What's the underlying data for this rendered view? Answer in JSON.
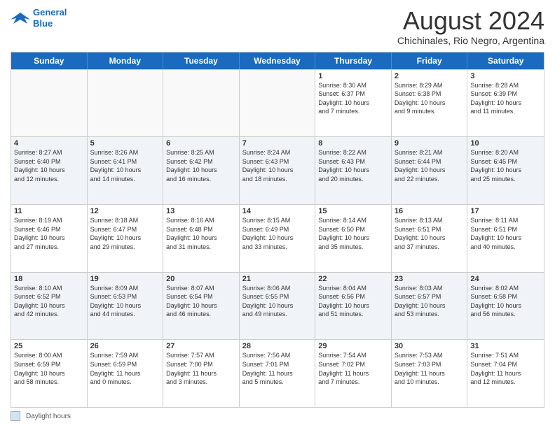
{
  "logo": {
    "line1": "General",
    "line2": "Blue"
  },
  "title": "August 2024",
  "location": "Chichinales, Rio Negro, Argentina",
  "header_days": [
    "Sunday",
    "Monday",
    "Tuesday",
    "Wednesday",
    "Thursday",
    "Friday",
    "Saturday"
  ],
  "footer": {
    "legend_label": "Daylight hours"
  },
  "rows": [
    [
      {
        "day": "",
        "lines": [],
        "empty": true
      },
      {
        "day": "",
        "lines": [],
        "empty": true
      },
      {
        "day": "",
        "lines": [],
        "empty": true
      },
      {
        "day": "",
        "lines": [],
        "empty": true
      },
      {
        "day": "1",
        "lines": [
          "Sunrise: 8:30 AM",
          "Sunset: 6:37 PM",
          "Daylight: 10 hours",
          "and 7 minutes."
        ],
        "empty": false
      },
      {
        "day": "2",
        "lines": [
          "Sunrise: 8:29 AM",
          "Sunset: 6:38 PM",
          "Daylight: 10 hours",
          "and 9 minutes."
        ],
        "empty": false
      },
      {
        "day": "3",
        "lines": [
          "Sunrise: 8:28 AM",
          "Sunset: 6:39 PM",
          "Daylight: 10 hours",
          "and 11 minutes."
        ],
        "empty": false
      }
    ],
    [
      {
        "day": "4",
        "lines": [
          "Sunrise: 8:27 AM",
          "Sunset: 6:40 PM",
          "Daylight: 10 hours",
          "and 12 minutes."
        ],
        "empty": false
      },
      {
        "day": "5",
        "lines": [
          "Sunrise: 8:26 AM",
          "Sunset: 6:41 PM",
          "Daylight: 10 hours",
          "and 14 minutes."
        ],
        "empty": false
      },
      {
        "day": "6",
        "lines": [
          "Sunrise: 8:25 AM",
          "Sunset: 6:42 PM",
          "Daylight: 10 hours",
          "and 16 minutes."
        ],
        "empty": false
      },
      {
        "day": "7",
        "lines": [
          "Sunrise: 8:24 AM",
          "Sunset: 6:43 PM",
          "Daylight: 10 hours",
          "and 18 minutes."
        ],
        "empty": false
      },
      {
        "day": "8",
        "lines": [
          "Sunrise: 8:22 AM",
          "Sunset: 6:43 PM",
          "Daylight: 10 hours",
          "and 20 minutes."
        ],
        "empty": false
      },
      {
        "day": "9",
        "lines": [
          "Sunrise: 8:21 AM",
          "Sunset: 6:44 PM",
          "Daylight: 10 hours",
          "and 22 minutes."
        ],
        "empty": false
      },
      {
        "day": "10",
        "lines": [
          "Sunrise: 8:20 AM",
          "Sunset: 6:45 PM",
          "Daylight: 10 hours",
          "and 25 minutes."
        ],
        "empty": false
      }
    ],
    [
      {
        "day": "11",
        "lines": [
          "Sunrise: 8:19 AM",
          "Sunset: 6:46 PM",
          "Daylight: 10 hours",
          "and 27 minutes."
        ],
        "empty": false
      },
      {
        "day": "12",
        "lines": [
          "Sunrise: 8:18 AM",
          "Sunset: 6:47 PM",
          "Daylight: 10 hours",
          "and 29 minutes."
        ],
        "empty": false
      },
      {
        "day": "13",
        "lines": [
          "Sunrise: 8:16 AM",
          "Sunset: 6:48 PM",
          "Daylight: 10 hours",
          "and 31 minutes."
        ],
        "empty": false
      },
      {
        "day": "14",
        "lines": [
          "Sunrise: 8:15 AM",
          "Sunset: 6:49 PM",
          "Daylight: 10 hours",
          "and 33 minutes."
        ],
        "empty": false
      },
      {
        "day": "15",
        "lines": [
          "Sunrise: 8:14 AM",
          "Sunset: 6:50 PM",
          "Daylight: 10 hours",
          "and 35 minutes."
        ],
        "empty": false
      },
      {
        "day": "16",
        "lines": [
          "Sunrise: 8:13 AM",
          "Sunset: 6:51 PM",
          "Daylight: 10 hours",
          "and 37 minutes."
        ],
        "empty": false
      },
      {
        "day": "17",
        "lines": [
          "Sunrise: 8:11 AM",
          "Sunset: 6:51 PM",
          "Daylight: 10 hours",
          "and 40 minutes."
        ],
        "empty": false
      }
    ],
    [
      {
        "day": "18",
        "lines": [
          "Sunrise: 8:10 AM",
          "Sunset: 6:52 PM",
          "Daylight: 10 hours",
          "and 42 minutes."
        ],
        "empty": false
      },
      {
        "day": "19",
        "lines": [
          "Sunrise: 8:09 AM",
          "Sunset: 6:53 PM",
          "Daylight: 10 hours",
          "and 44 minutes."
        ],
        "empty": false
      },
      {
        "day": "20",
        "lines": [
          "Sunrise: 8:07 AM",
          "Sunset: 6:54 PM",
          "Daylight: 10 hours",
          "and 46 minutes."
        ],
        "empty": false
      },
      {
        "day": "21",
        "lines": [
          "Sunrise: 8:06 AM",
          "Sunset: 6:55 PM",
          "Daylight: 10 hours",
          "and 49 minutes."
        ],
        "empty": false
      },
      {
        "day": "22",
        "lines": [
          "Sunrise: 8:04 AM",
          "Sunset: 6:56 PM",
          "Daylight: 10 hours",
          "and 51 minutes."
        ],
        "empty": false
      },
      {
        "day": "23",
        "lines": [
          "Sunrise: 8:03 AM",
          "Sunset: 6:57 PM",
          "Daylight: 10 hours",
          "and 53 minutes."
        ],
        "empty": false
      },
      {
        "day": "24",
        "lines": [
          "Sunrise: 8:02 AM",
          "Sunset: 6:58 PM",
          "Daylight: 10 hours",
          "and 56 minutes."
        ],
        "empty": false
      }
    ],
    [
      {
        "day": "25",
        "lines": [
          "Sunrise: 8:00 AM",
          "Sunset: 6:59 PM",
          "Daylight: 10 hours",
          "and 58 minutes."
        ],
        "empty": false
      },
      {
        "day": "26",
        "lines": [
          "Sunrise: 7:59 AM",
          "Sunset: 6:59 PM",
          "Daylight: 11 hours",
          "and 0 minutes."
        ],
        "empty": false
      },
      {
        "day": "27",
        "lines": [
          "Sunrise: 7:57 AM",
          "Sunset: 7:00 PM",
          "Daylight: 11 hours",
          "and 3 minutes."
        ],
        "empty": false
      },
      {
        "day": "28",
        "lines": [
          "Sunrise: 7:56 AM",
          "Sunset: 7:01 PM",
          "Daylight: 11 hours",
          "and 5 minutes."
        ],
        "empty": false
      },
      {
        "day": "29",
        "lines": [
          "Sunrise: 7:54 AM",
          "Sunset: 7:02 PM",
          "Daylight: 11 hours",
          "and 7 minutes."
        ],
        "empty": false
      },
      {
        "day": "30",
        "lines": [
          "Sunrise: 7:53 AM",
          "Sunset: 7:03 PM",
          "Daylight: 11 hours",
          "and 10 minutes."
        ],
        "empty": false
      },
      {
        "day": "31",
        "lines": [
          "Sunrise: 7:51 AM",
          "Sunset: 7:04 PM",
          "Daylight: 11 hours",
          "and 12 minutes."
        ],
        "empty": false
      }
    ]
  ]
}
